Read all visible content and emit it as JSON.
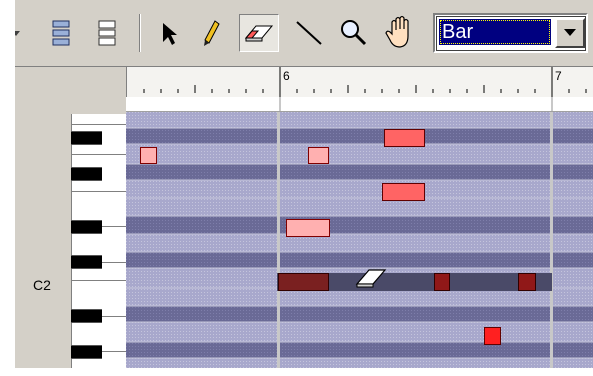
{
  "toolbar": {
    "tools": [
      "layout-toggle-icon",
      "layout-split-icon",
      "pointer-icon",
      "pencil-icon",
      "eraser-icon",
      "line-icon",
      "magnify-icon",
      "hand-icon"
    ],
    "active_tool": "eraser-icon",
    "snap_value": "Bar"
  },
  "ruler": {
    "bars": [
      "6",
      "7"
    ]
  },
  "keyboard": {
    "label": "C2"
  },
  "colors": {
    "lane_dark": "#6a6a96",
    "lane_light": "#a8a8cc",
    "note_red": "#ff6464",
    "note_pink": "#ffb0b0",
    "note_dark": "#7a2020"
  }
}
